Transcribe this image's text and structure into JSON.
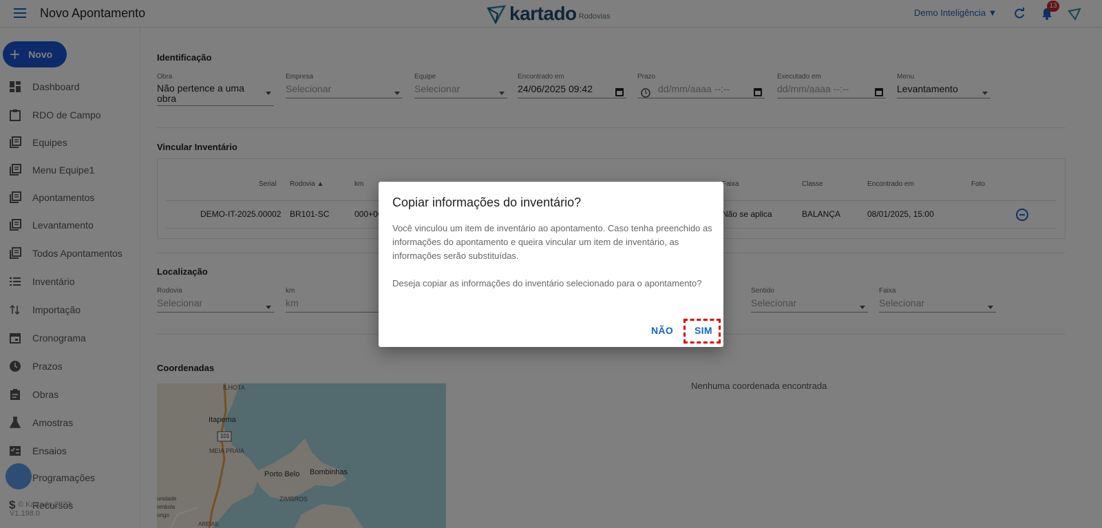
{
  "header": {
    "title": "Novo Apontamento",
    "logo_text": "kartado",
    "logo_sub": "Rodovias",
    "user_menu": "Demo Inteligência ▼",
    "notification_count": "13"
  },
  "sidebar": {
    "new_button": "Novo",
    "items": [
      {
        "label": "Dashboard",
        "icon": "dashboard-icon"
      },
      {
        "label": "RDO de Campo",
        "icon": "clipboard-icon"
      },
      {
        "label": "Equipes",
        "icon": "library-icon"
      },
      {
        "label": "Menu Equipe1",
        "icon": "library-icon"
      },
      {
        "label": "Apontamentos",
        "icon": "library-icon"
      },
      {
        "label": "Levantamento",
        "icon": "library-icon"
      },
      {
        "label": "Todos Apontamentos",
        "icon": "library-icon"
      },
      {
        "label": "Inventário",
        "icon": "list-icon"
      },
      {
        "label": "Importação",
        "icon": "import-icon"
      },
      {
        "label": "Cronograma",
        "icon": "calendar-icon"
      },
      {
        "label": "Prazos",
        "icon": "clock-icon"
      },
      {
        "label": "Obras",
        "icon": "assignment-icon"
      },
      {
        "label": "Amostras",
        "icon": "flask-icon"
      },
      {
        "label": "Ensaios",
        "icon": "checklist-icon"
      },
      {
        "label": "Programações",
        "icon": "schedule-icon"
      },
      {
        "label": "Recursos",
        "icon": "dollar-icon"
      }
    ],
    "footer_copyright": "© Kartado 2023",
    "footer_version": "V1.198.0"
  },
  "identificacao": {
    "title": "Identificação",
    "obra": {
      "label": "Obra",
      "value": "Não pertence a uma obra"
    },
    "empresa": {
      "label": "Empresa",
      "placeholder": "Selecionar"
    },
    "equipe": {
      "label": "Equipe",
      "placeholder": "Selecionar"
    },
    "encontrado": {
      "label": "Encontrado em",
      "value": "24/06/2025 09:42"
    },
    "prazo": {
      "label": "Prazo",
      "placeholder": "dd/mm/aaaa --:--"
    },
    "executado": {
      "label": "Executado em",
      "placeholder": "dd/mm/aaaa --:--"
    },
    "menu": {
      "label": "Menu",
      "value": "Levantamento"
    }
  },
  "inventario": {
    "title": "Vincular Inventário",
    "columns": {
      "serial": "Serial",
      "rodovia": "Rodovia ▲",
      "km": "km",
      "faixa": "Faixa",
      "classe": "Classe",
      "encontrado": "Encontrado em",
      "foto": "Foto"
    },
    "row": {
      "serial": "DEMO-IT-2025.00002",
      "rodovia": "BR101-SC",
      "km": "000+00",
      "faixa": "Não se aplica",
      "classe": "BALANÇA",
      "encontrado": "08/01/2025, 15:00"
    }
  },
  "localizacao": {
    "title": "Localização",
    "rodovia": {
      "label": "Rodovia",
      "placeholder": "Selecionar"
    },
    "km": {
      "label": "km",
      "placeholder": "km"
    },
    "sentido": {
      "label": "Sentido",
      "placeholder": "Selecionar"
    },
    "faixa": {
      "label": "Faixa",
      "placeholder": "Selecionar"
    }
  },
  "coordenadas": {
    "title": "Coordenadas",
    "empty_text": "Nenhuma coordenada encontrada",
    "map_labels": {
      "ilhota": "ILHOTA",
      "itapema": "Itapema",
      "road": "101",
      "meia_praia": "MEIA PRAIA",
      "porto_belo": "Porto Belo",
      "bombinhas": "Bombinhas",
      "zimbros": "ZIMBROS",
      "unidade": "unidade",
      "ombola": "ombola",
      "ongo": "ongo",
      "areias": "AREIAS"
    }
  },
  "dialog": {
    "title": "Copiar informações do inventário?",
    "paragraph1": "Você vinculou um item de inventário ao apontamento. Caso tenha preenchido as informações do apontamento e queira vincular um item de inventário, as informações serão substituídas.",
    "paragraph2": "Deseja copiar as informações do inventário selecionado para o apontamento?",
    "no_label": "NÃO",
    "yes_label": "SIM"
  },
  "colors": {
    "accent": "#1565c0",
    "new_button": "#1a56d6",
    "highlight": "#e00000"
  }
}
